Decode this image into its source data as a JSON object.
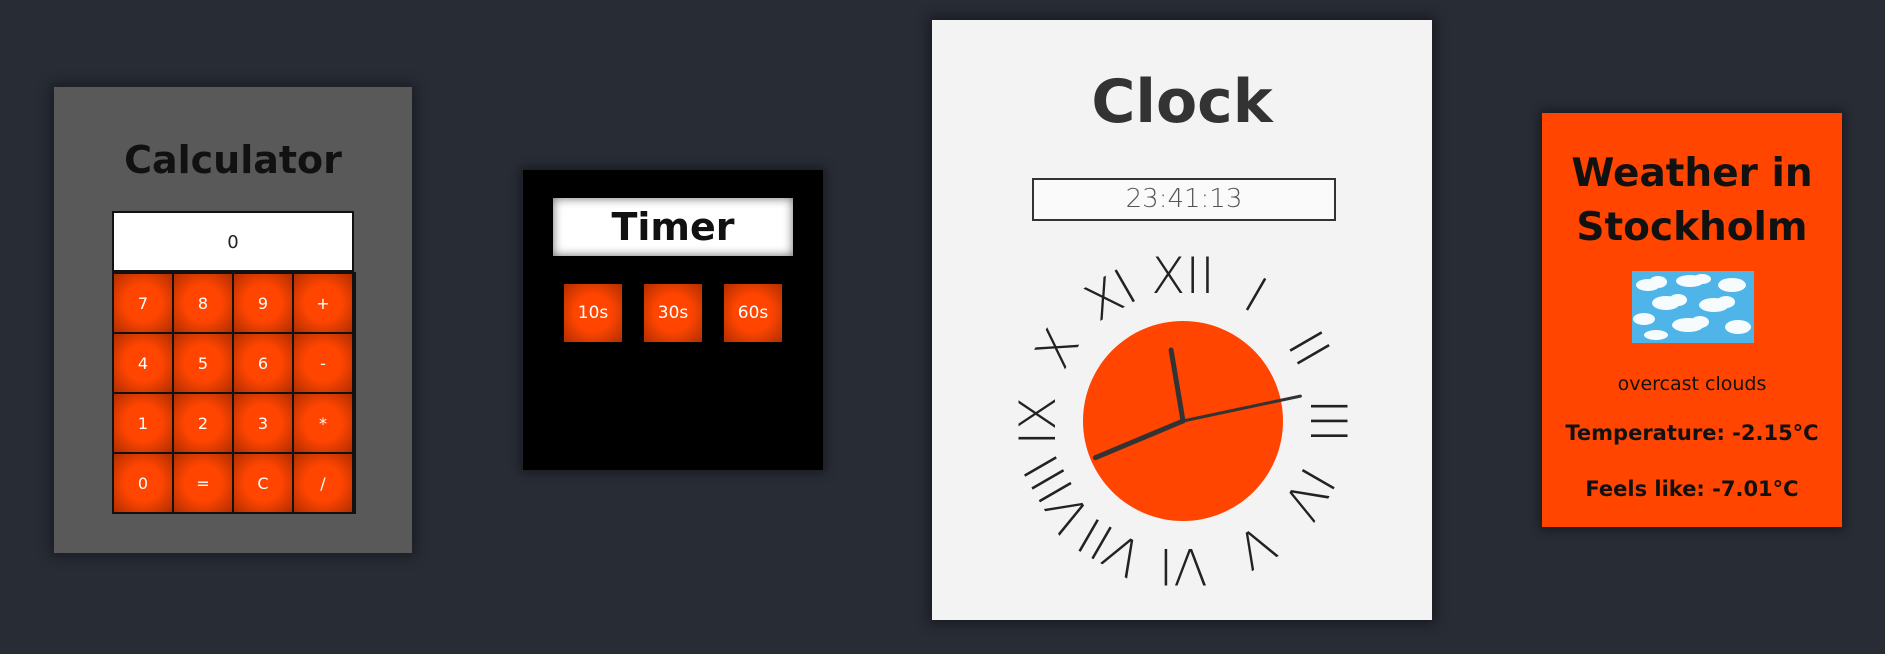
{
  "calculator": {
    "title": "Calculator",
    "display": "0",
    "keys": [
      "7",
      "8",
      "9",
      "+",
      "4",
      "5",
      "6",
      "-",
      "1",
      "2",
      "3",
      "*",
      "0",
      "=",
      "C",
      "/"
    ]
  },
  "timer": {
    "title": "Timer",
    "buttons": [
      "10s",
      "30s",
      "60s"
    ]
  },
  "clock": {
    "title": "Clock",
    "digital_time": "23:41:13",
    "numerals": [
      "XII",
      "I",
      "II",
      "III",
      "IV",
      "V",
      "VI",
      "VII",
      "VIII",
      "IX",
      "X",
      "XI"
    ],
    "face_color": "#ff4500",
    "hands": {
      "hour": 23,
      "minute": 41,
      "second": 13
    }
  },
  "weather": {
    "title": "Weather in Stockholm",
    "icon": "overcast-clouds-icon",
    "description": "overcast clouds",
    "temperature": "Temperature: -2.15°C",
    "feels_like": "Feels like: -7.01°C"
  },
  "colors": {
    "accent": "#ff4500",
    "background": "#282c35"
  }
}
